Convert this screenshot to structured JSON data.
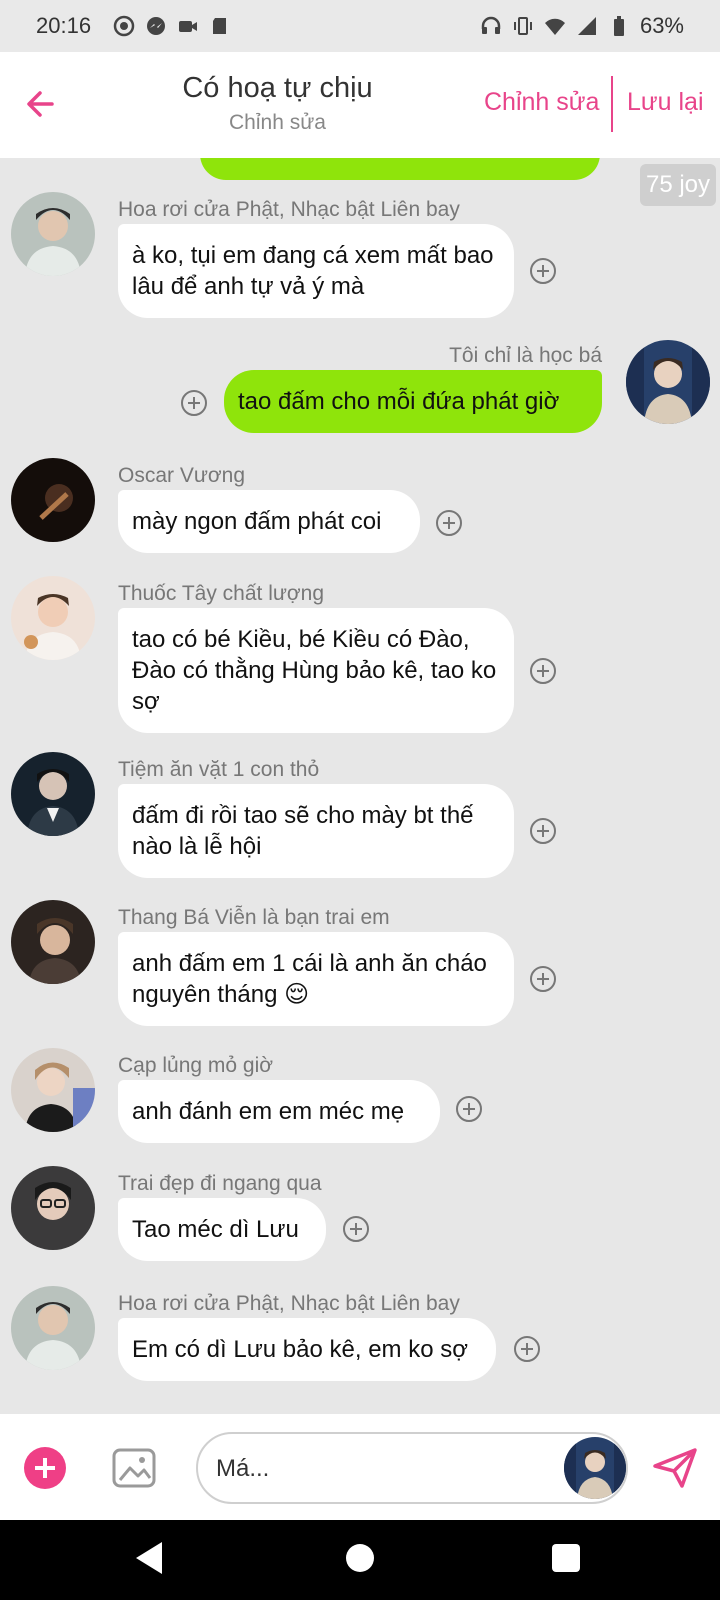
{
  "status_bar": {
    "time": "20:16",
    "battery": "63%"
  },
  "header": {
    "title": "Có hoạ tự chịu",
    "subtitle": "Chỉnh sửa",
    "edit_label": "Chỉnh sửa",
    "save_label": "Lưu lại"
  },
  "joy_badge": "75 joy",
  "messages": [
    {
      "sender": "Hoa rơi cửa Phật, Nhạc bật Liên bay",
      "text": "à ko, tụi em đang cá xem mất bao lâu để anh tự vả ý mà"
    },
    {
      "sender": "Tôi chỉ là học bá",
      "text": "tao đấm cho mỗi đứa phát giờ"
    },
    {
      "sender": "Oscar Vương",
      "text": "mày ngon đấm phát coi"
    },
    {
      "sender": "Thuốc Tây chất lượng",
      "text": "tao có bé Kiều, bé Kiều có Đào, Đào có thằng Hùng bảo kê, tao ko sợ"
    },
    {
      "sender": "Tiệm ăn vặt 1 con thỏ",
      "text": "đấm đi rồi tao sẽ cho mày bt thế nào là lễ hội"
    },
    {
      "sender": "Thang Bá Viễn là bạn trai em",
      "text": "anh đấm em 1 cái là anh ăn cháo nguyên tháng 😌"
    },
    {
      "sender": "Cạp lủng mỏ giờ",
      "text": "anh đánh em em méc mẹ"
    },
    {
      "sender": "Trai đẹp đi ngang qua",
      "text": "Tao méc dì Lưu"
    },
    {
      "sender": "Hoa rơi cửa Phật, Nhạc bật Liên bay",
      "text": "Em có dì Lưu bảo kê, em ko sợ"
    }
  ],
  "input": {
    "placeholder": "Má..."
  },
  "colors": {
    "accent": "#e8448a",
    "outgoing_bubble": "#8fe40b",
    "incoming_bubble": "#ffffff",
    "background": "#e7e7e7"
  }
}
